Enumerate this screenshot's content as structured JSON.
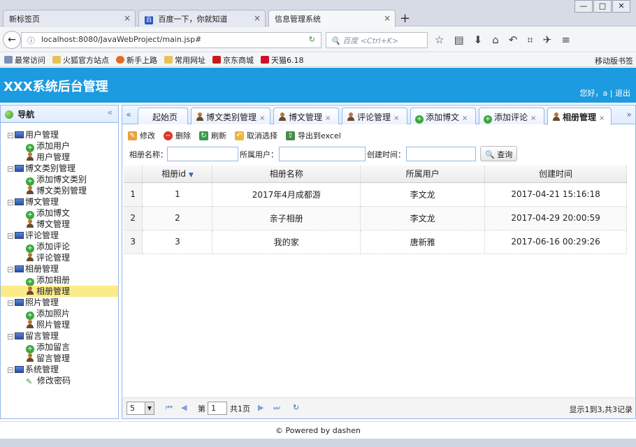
{
  "browser": {
    "tabs": [
      {
        "label": "新标签页"
      },
      {
        "label": "百度一下，你就知道"
      },
      {
        "label": "信息管理系统"
      }
    ],
    "close_glyph": "×",
    "new_tab_glyph": "+",
    "url": "localhost:8080/JavaWebProject/main.jsp#",
    "search_placeholder": "百度 <Ctrl+K>",
    "bookmarks": [
      "最常访问",
      "火狐官方站点",
      "新手上路",
      "常用网址",
      "京东商城",
      "天猫6.18"
    ],
    "bookmark_right": "移动版书签"
  },
  "app": {
    "title": "XXX系统后台管理",
    "user_info": "您好，a | 退出"
  },
  "nav": {
    "title": "导航",
    "collapse_glyph": "«",
    "groups": [
      {
        "label": "用户管理",
        "items": [
          {
            "label": "添加用户",
            "icon": "add"
          },
          {
            "label": "用户管理",
            "icon": "user"
          }
        ]
      },
      {
        "label": "博文类别管理",
        "items": [
          {
            "label": "添加博文类别",
            "icon": "add"
          },
          {
            "label": "博文类别管理",
            "icon": "user"
          }
        ]
      },
      {
        "label": "博文管理",
        "items": [
          {
            "label": "添加博文",
            "icon": "add"
          },
          {
            "label": "博文管理",
            "icon": "user"
          }
        ]
      },
      {
        "label": "评论管理",
        "items": [
          {
            "label": "添加评论",
            "icon": "add"
          },
          {
            "label": "评论管理",
            "icon": "user"
          }
        ]
      },
      {
        "label": "相册管理",
        "items": [
          {
            "label": "添加相册",
            "icon": "add"
          },
          {
            "label": "相册管理",
            "icon": "user",
            "selected": true
          }
        ]
      },
      {
        "label": "照片管理",
        "items": [
          {
            "label": "添加照片",
            "icon": "add"
          },
          {
            "label": "照片管理",
            "icon": "user"
          }
        ]
      },
      {
        "label": "留言管理",
        "items": [
          {
            "label": "添加留言",
            "icon": "add"
          },
          {
            "label": "留言管理",
            "icon": "user"
          }
        ]
      },
      {
        "label": "系统管理",
        "items": [
          {
            "label": "修改密码",
            "icon": "pen"
          }
        ]
      }
    ]
  },
  "content_tabs": [
    {
      "label": "起始页",
      "icon": "none",
      "closable": false
    },
    {
      "label": "博文类别管理",
      "icon": "user",
      "closable": true
    },
    {
      "label": "博文管理",
      "icon": "user",
      "closable": true
    },
    {
      "label": "评论管理",
      "icon": "user",
      "closable": true
    },
    {
      "label": "添加博文",
      "icon": "add",
      "closable": true
    },
    {
      "label": "添加评论",
      "icon": "add",
      "closable": true
    },
    {
      "label": "相册管理",
      "icon": "user",
      "closable": true,
      "active": true
    }
  ],
  "toolbar": {
    "edit": "修改",
    "delete": "删除",
    "refresh": "刷新",
    "cancel_select": "取消选择",
    "export": "导出到excel"
  },
  "filters": {
    "album_name_label": "相册名称：",
    "owner_label": "所属用户：",
    "created_label": "创建时间：",
    "query_button": "查询"
  },
  "grid": {
    "columns": [
      "相册id",
      "相册名称",
      "所属用户",
      "创建时间"
    ],
    "rows": [
      {
        "rownum": "1",
        "id": "1",
        "name": "2017年4月成都游",
        "owner": "李文龙",
        "created": "2017-04-21 15:16:18"
      },
      {
        "rownum": "2",
        "id": "2",
        "name": "亲子相册",
        "owner": "李文龙",
        "created": "2017-04-29 20:00:59"
      },
      {
        "rownum": "3",
        "id": "3",
        "name": "我的家",
        "owner": "唐新雅",
        "created": "2017-06-16 00:29:26"
      }
    ]
  },
  "pager": {
    "page_size": "5",
    "page_label": "第",
    "page_value": "1",
    "total_pages": "共1页",
    "summary": "显示1到3,共3记录"
  },
  "footer": {
    "text": "© Powered by dashen"
  }
}
